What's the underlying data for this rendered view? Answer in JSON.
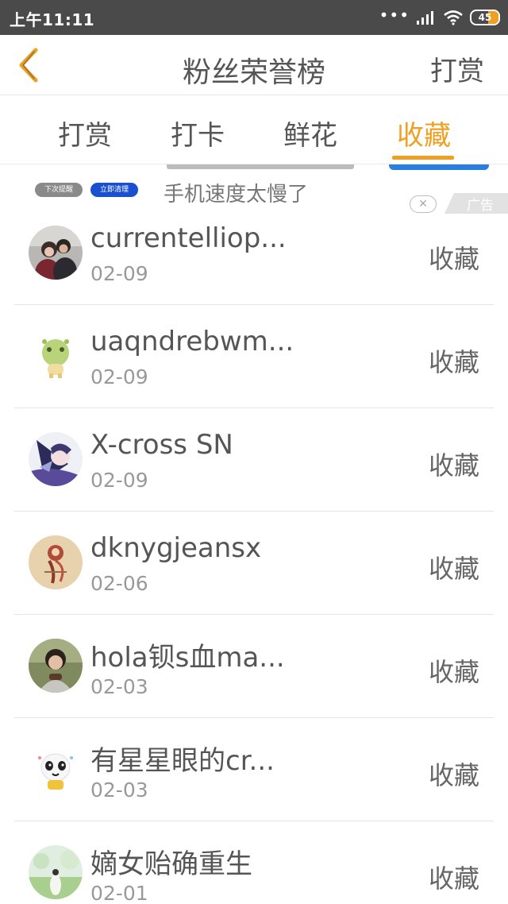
{
  "status_bar": {
    "time": "上午11:11",
    "battery": "45",
    "battery_color": "#f0a020"
  },
  "header": {
    "title": "粉丝荣誉榜",
    "right_action": "打赏",
    "back_icon": "chevron-left-icon",
    "accent_color": "#f0a020"
  },
  "tabs": [
    {
      "label": "打赏",
      "active": false
    },
    {
      "label": "打卡",
      "active": false
    },
    {
      "label": "鲜花",
      "active": false
    },
    {
      "label": "收藏",
      "active": true
    }
  ],
  "ad": {
    "button_gray": "下次提醒",
    "button_blue": "立即清理",
    "text": "手机速度太慢了",
    "badge": "广告"
  },
  "fans": [
    {
      "name": "currentelliop...",
      "date": "02-09",
      "action": "收藏",
      "avatar": "couple-photo"
    },
    {
      "name": "uaqndrebwm...",
      "date": "02-09",
      "action": "收藏",
      "avatar": "green-cartoon"
    },
    {
      "name": "X-cross SN",
      "date": "02-09",
      "action": "收藏",
      "avatar": "anime-character"
    },
    {
      "name": "dknygjeansx",
      "date": "02-06",
      "action": "收藏",
      "avatar": "illustrated-figure"
    },
    {
      "name": "hola钡s血ma...",
      "date": "02-03",
      "action": "收藏",
      "avatar": "woman-photo"
    },
    {
      "name": "有星星眼的cr...",
      "date": "02-03",
      "action": "收藏",
      "avatar": "panda-cartoon"
    },
    {
      "name": "嫡女贻确重生",
      "date": "02-01",
      "action": "收藏",
      "avatar": "landscape-figure"
    }
  ]
}
